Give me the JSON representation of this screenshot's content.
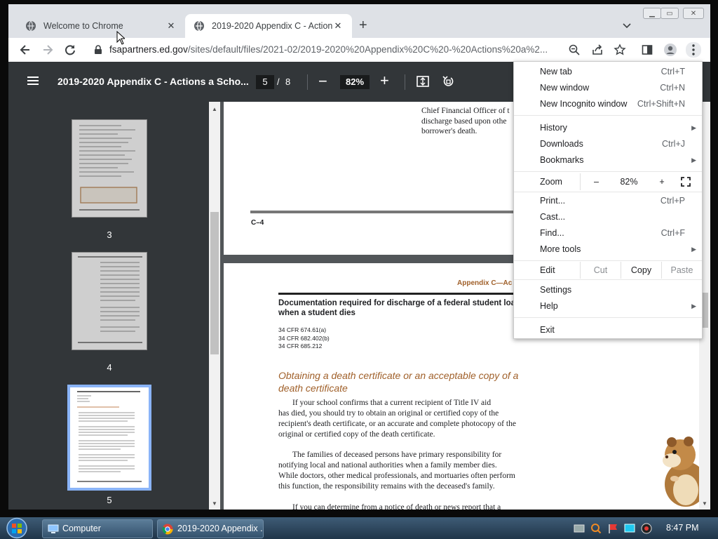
{
  "browser": {
    "tabs": [
      {
        "title": "Welcome to Chrome",
        "active": false
      },
      {
        "title": "2019-2020 Appendix C - Actions",
        "active": true
      }
    ],
    "url_host": "fsapartners.ed.gov",
    "url_path": "/sites/default/files/2021-02/2019-2020%20Appendix%20C%20-%20Actions%20a%2...",
    "icons": [
      "back-icon",
      "forward-icon",
      "reload-icon",
      "lock-icon",
      "zoom-icon",
      "share-icon",
      "star-icon",
      "side-panel-icon",
      "profile-icon",
      "kebab-menu-icon"
    ]
  },
  "pdf": {
    "title": "2019-2020 Appendix C - Actions a Scho...",
    "page": "5",
    "slash": "/",
    "total": "8",
    "zoom": "82%",
    "thumbnails": [
      {
        "label": "3"
      },
      {
        "label": "4"
      },
      {
        "label": "5"
      }
    ]
  },
  "document": {
    "page4_right_text": [
      "Chief Financial Officer of t",
      "discharge based upon othe",
      "borrower's death."
    ],
    "page4_footer": "C–4",
    "page5_header": "Appendix C—Ac",
    "doc_heading": [
      "Documentation required for discharge of a federal student loa",
      "when a student dies"
    ],
    "cfr_refs": [
      "34 CFR 674.61(a)",
      "34 CFR 682.402(b)",
      "34 CFR 685.212"
    ],
    "section_title": [
      "Obtaining a death certificate or an acceptable copy of a",
      "death certificate"
    ],
    "para1": [
      "If your school confirms that a current recipient of Title IV aid",
      "has died, you should try to obtain an original or certified copy of the",
      "recipient's death certificate, or an accurate and complete photocopy of the",
      "original or certified copy of the death certificate."
    ],
    "para2": [
      "The families of deceased persons have primary responsibility for",
      "notifying local and national authorities when a family member dies.",
      "While doctors, other medical professionals, and mortuaries often perform",
      "this function, the responsibility remains with the deceased's family."
    ],
    "para3": [
      "If you can determine from a notice of death or news report that a"
    ]
  },
  "menu": {
    "new_tab": "New tab",
    "new_tab_key": "Ctrl+T",
    "new_window": "New window",
    "new_window_key": "Ctrl+N",
    "incognito": "New Incognito window",
    "incognito_key": "Ctrl+Shift+N",
    "history": "History",
    "downloads": "Downloads",
    "downloads_key": "Ctrl+J",
    "bookmarks": "Bookmarks",
    "zoom": "Zoom",
    "zoom_minus": "–",
    "zoom_value": "82%",
    "zoom_plus": "+",
    "print": "Print...",
    "print_key": "Ctrl+P",
    "cast": "Cast...",
    "find": "Find...",
    "find_key": "Ctrl+F",
    "more_tools": "More tools",
    "edit": "Edit",
    "cut": "Cut",
    "copy": "Copy",
    "paste": "Paste",
    "settings": "Settings",
    "help": "Help",
    "exit": "Exit"
  },
  "taskbar": {
    "items": [
      "Computer",
      "2019-2020 Appendix ..."
    ],
    "clock": "8:47 PM"
  },
  "colors": {
    "accent_heading": "#a0602a",
    "pdf_toolbar": "#323639",
    "selected_thumb": "#8ab4f8"
  }
}
